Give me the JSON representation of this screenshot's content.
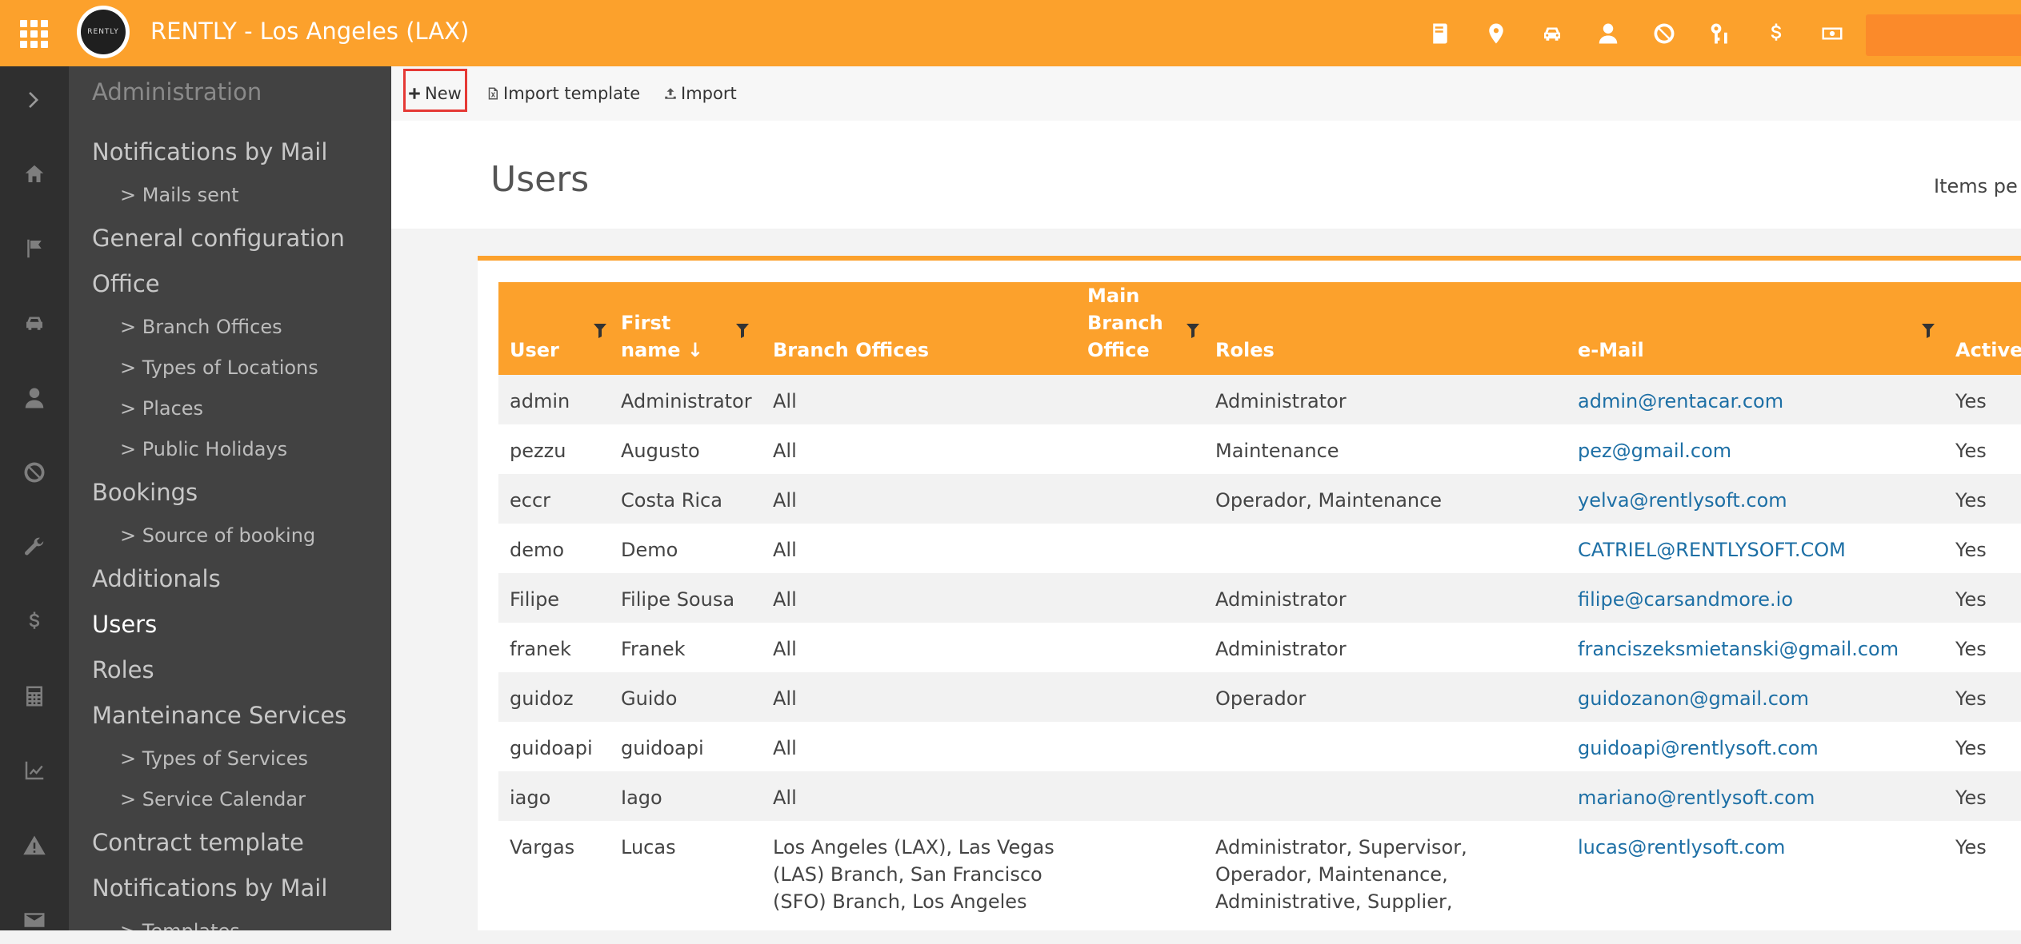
{
  "header": {
    "title": "RENTLY - Los Angeles (LAX)",
    "logo_text": "RENTLY",
    "accent_color": "#fca12c",
    "icons": [
      "book-icon",
      "location-pin-icon",
      "car-icon",
      "user-icon",
      "ban-icon",
      "keys-icon",
      "dollar-icon",
      "cash-icon"
    ]
  },
  "rail": {
    "icons": [
      "expand-chevron-icon",
      "home-icon",
      "flag-icon",
      "car-icon",
      "user-icon",
      "ban-icon",
      "wrench-icon",
      "dollar-icon",
      "calculator-icon",
      "chart-line-icon",
      "warning-icon",
      "mail-icon"
    ]
  },
  "sidebar": {
    "header": "Administration",
    "items": [
      {
        "label": "Notifications by Mail",
        "level": 1
      },
      {
        "label": "> Mails sent",
        "level": 2
      },
      {
        "label": "General configuration",
        "level": 1
      },
      {
        "label": "Office",
        "level": 1
      },
      {
        "label": "> Branch Offices",
        "level": 2
      },
      {
        "label": "> Types of Locations",
        "level": 2
      },
      {
        "label": "> Places",
        "level": 2
      },
      {
        "label": "> Public Holidays",
        "level": 2
      },
      {
        "label": "Bookings",
        "level": 1
      },
      {
        "label": "> Source of booking",
        "level": 2
      },
      {
        "label": "Additionals",
        "level": 1
      },
      {
        "label": "Users",
        "level": 1,
        "active": true
      },
      {
        "label": "Roles",
        "level": 1
      },
      {
        "label": "Manteinance Services",
        "level": 1
      },
      {
        "label": "> Types of Services",
        "level": 2
      },
      {
        "label": "> Service Calendar",
        "level": 2
      },
      {
        "label": "Contract template",
        "level": 1
      },
      {
        "label": "Notifications by Mail",
        "level": 1
      },
      {
        "label": "> Templates",
        "level": 2
      }
    ]
  },
  "toolbar": {
    "new_label": "New",
    "import_template_label": "Import template",
    "import_label": "Import"
  },
  "page": {
    "title": "Users",
    "items_per_page_label": "Items pe"
  },
  "table": {
    "columns": [
      {
        "label": "User",
        "filter": true
      },
      {
        "label": "First name ↓",
        "filter": true
      },
      {
        "label": "Branch Offices",
        "filter": false
      },
      {
        "label": "Main Branch Office",
        "filter": true
      },
      {
        "label": "Roles",
        "filter": false
      },
      {
        "label": "e-Mail",
        "filter": true
      },
      {
        "label": "Active",
        "filter": false
      }
    ],
    "rows": [
      {
        "user": "admin",
        "first_name": "Administrator",
        "branch_offices": "All",
        "main_branch": "",
        "roles": "Administrator",
        "email": "admin@rentacar.com",
        "active": "Yes"
      },
      {
        "user": "pezzu",
        "first_name": "Augusto",
        "branch_offices": "All",
        "main_branch": "",
        "roles": "Maintenance",
        "email": "pez@gmail.com",
        "active": "Yes"
      },
      {
        "user": "eccr",
        "first_name": "Costa Rica",
        "branch_offices": "All",
        "main_branch": "",
        "roles": "Operador, Maintenance",
        "email": "yelva@rentlysoft.com",
        "active": "Yes"
      },
      {
        "user": "demo",
        "first_name": "Demo",
        "branch_offices": "All",
        "main_branch": "",
        "roles": "",
        "email": "CATRIEL@RENTLYSOFT.COM",
        "active": "Yes"
      },
      {
        "user": "Filipe",
        "first_name": "Filipe Sousa",
        "branch_offices": "All",
        "main_branch": "",
        "roles": "Administrator",
        "email": "filipe@carsandmore.io",
        "active": "Yes"
      },
      {
        "user": "franek",
        "first_name": "Franek",
        "branch_offices": "All",
        "main_branch": "",
        "roles": "Administrator",
        "email": "franciszeksmietanski@gmail.com",
        "active": "Yes"
      },
      {
        "user": "guidoz",
        "first_name": "Guido",
        "branch_offices": "All",
        "main_branch": "",
        "roles": "Operador",
        "email": "guidozanon@gmail.com",
        "active": "Yes"
      },
      {
        "user": "guidoapi",
        "first_name": "guidoapi",
        "branch_offices": "All",
        "main_branch": "",
        "roles": "",
        "email": "guidoapi@rentlysoft.com",
        "active": "Yes"
      },
      {
        "user": "iago",
        "first_name": "Iago",
        "branch_offices": "All",
        "main_branch": "",
        "roles": "",
        "email": "mariano@rentlysoft.com",
        "active": "Yes"
      },
      {
        "user": "Vargas",
        "first_name": "Lucas",
        "branch_offices": "Los Angeles (LAX), Las Vegas (LAS) Branch, San Francisco (SFO) Branch, Los Angeles",
        "main_branch": "",
        "roles": "Administrator, Supervisor, Operador, Maintenance, Administrative, Supplier,",
        "email": "lucas@rentlysoft.com",
        "active": "Yes"
      }
    ]
  }
}
